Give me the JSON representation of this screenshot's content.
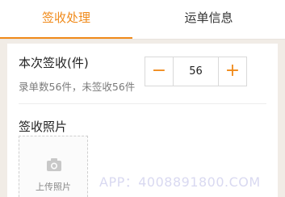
{
  "tabs": [
    {
      "label": "签收处理",
      "active": true
    },
    {
      "label": "运单信息",
      "active": false
    }
  ],
  "sign": {
    "count_label": "本次签收(件)",
    "summary": "录单数56件，未签收56件",
    "quantity": "56",
    "minus_symbol": "−",
    "plus_symbol": "+"
  },
  "photo": {
    "label": "签收照片",
    "upload_text": "上传照片",
    "icon": "camera-icon"
  },
  "watermark": "APP：4008891800.COM",
  "colors": {
    "accent": "#f08a1a",
    "background": "#f1ece6",
    "text": "#222222",
    "muted": "#7a7a7a"
  }
}
